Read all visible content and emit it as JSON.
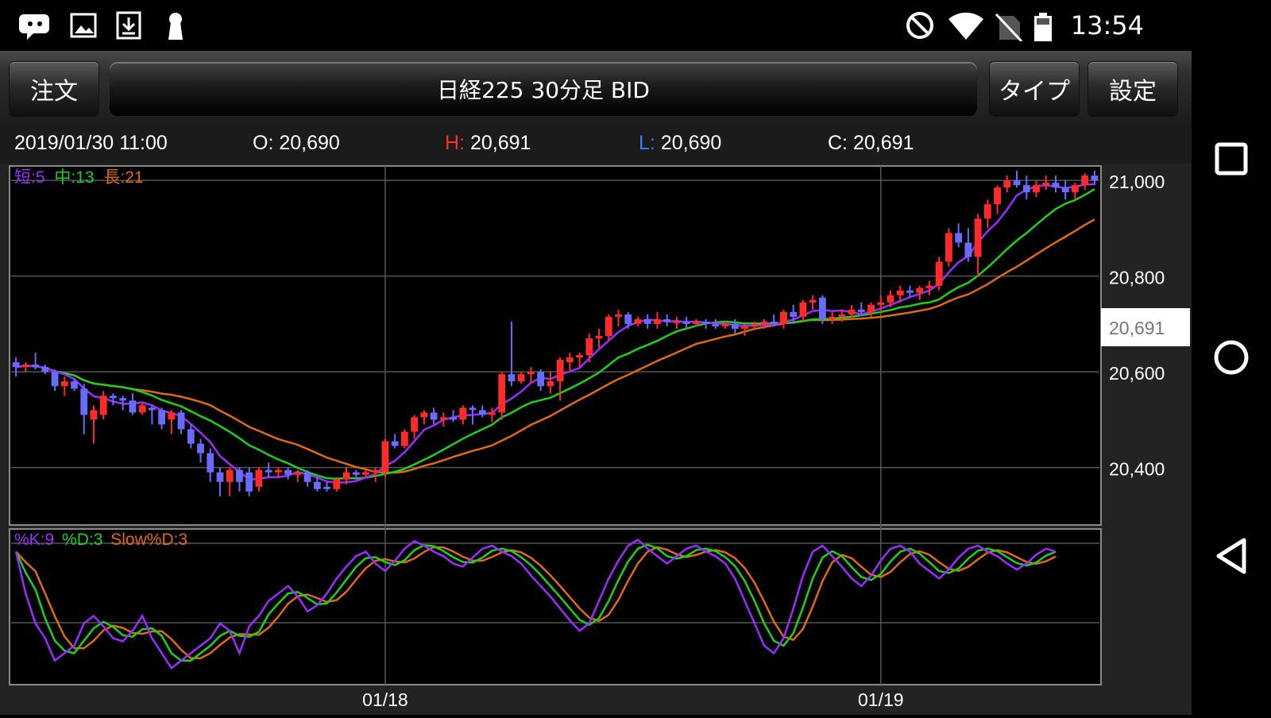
{
  "status_bar": {
    "time": "13:54",
    "left_icons": [
      "message-icon",
      "image-icon",
      "download-icon",
      "keyhole-icon"
    ],
    "right_icons": [
      "do-not-disturb-icon",
      "wifi-icon",
      "no-sim-icon",
      "battery-icon"
    ]
  },
  "toolbar": {
    "order_label": "注文",
    "title": "日経225 30分足 BID",
    "type_label": "タイプ",
    "settings_label": "設定"
  },
  "ohlc": {
    "datetime": "2019/01/30 11:00",
    "open_label": "O:",
    "open": "20,690",
    "high_label": "H:",
    "high": "20,691",
    "low_label": "L:",
    "low": "20,690",
    "close_label": "C:",
    "close": "20,691"
  },
  "colors": {
    "up": "#ff2a2a",
    "down": "#6a6aff",
    "ma_short": "#9a2cff",
    "ma_mid": "#1bd11b",
    "ma_long": "#e06a12",
    "high_label": "#ff3030",
    "low_label": "#3a7aff"
  },
  "legend": {
    "ma_short": "短:5",
    "ma_mid": "中:13",
    "ma_long": "長:21",
    "stoch_k": "%K:9",
    "stoch_d": "%D:3",
    "stoch_slow": "Slow%D:3"
  },
  "chart_data": {
    "type": "candlestick",
    "title": "日経225 30分足 BID",
    "y_ticks": [
      21000,
      20800,
      20600,
      20400
    ],
    "y_tick_labels": [
      "21,000",
      "20,800",
      "20,600",
      "20,400"
    ],
    "ylim": [
      20280,
      21030
    ],
    "current_price": 20691,
    "current_price_label": "20,691",
    "x_tick_labels": [
      "01/18",
      "01/19"
    ],
    "x_tick_index": [
      38,
      89
    ],
    "candles": [
      [
        20620,
        20630,
        20590,
        20610
      ],
      [
        20610,
        20620,
        20600,
        20615
      ],
      [
        20615,
        20640,
        20605,
        20610
      ],
      [
        20610,
        20615,
        20595,
        20600
      ],
      [
        20600,
        20605,
        20560,
        20570
      ],
      [
        20570,
        20590,
        20550,
        20580
      ],
      [
        20580,
        20585,
        20560,
        20565
      ],
      [
        20565,
        20575,
        20470,
        20510
      ],
      [
        20500,
        20530,
        20450,
        20520
      ],
      [
        20510,
        20560,
        20500,
        20550
      ],
      [
        20550,
        20555,
        20530,
        20545
      ],
      [
        20545,
        20550,
        20520,
        20540
      ],
      [
        20540,
        20555,
        20510,
        20515
      ],
      [
        20515,
        20535,
        20510,
        20530
      ],
      [
        20525,
        20530,
        20490,
        20520
      ],
      [
        20520,
        20525,
        20480,
        20490
      ],
      [
        20500,
        20520,
        20470,
        20515
      ],
      [
        20515,
        20520,
        20470,
        20480
      ],
      [
        20480,
        20490,
        20440,
        20450
      ],
      [
        20450,
        20460,
        20410,
        20430
      ],
      [
        20430,
        20440,
        20370,
        20390
      ],
      [
        20390,
        20400,
        20340,
        20370
      ],
      [
        20370,
        20400,
        20340,
        20395
      ],
      [
        20395,
        20400,
        20350,
        20370
      ],
      [
        20390,
        20400,
        20340,
        20350
      ],
      [
        20360,
        20400,
        20350,
        20395
      ],
      [
        20395,
        20410,
        20380,
        20390
      ],
      [
        20390,
        20400,
        20380,
        20395
      ],
      [
        20395,
        20400,
        20375,
        20385
      ],
      [
        20385,
        20395,
        20370,
        20390
      ],
      [
        20390,
        20395,
        20360,
        20370
      ],
      [
        20370,
        20380,
        20350,
        20355
      ],
      [
        20360,
        20370,
        20350,
        20355
      ],
      [
        20355,
        20380,
        20350,
        20375
      ],
      [
        20375,
        20400,
        20365,
        20390
      ],
      [
        20390,
        20395,
        20375,
        20385
      ],
      [
        20385,
        20395,
        20380,
        20390
      ],
      [
        20390,
        20400,
        20370,
        20395
      ],
      [
        20390,
        20460,
        20380,
        20455
      ],
      [
        20455,
        20470,
        20440,
        20445
      ],
      [
        20445,
        20480,
        20440,
        20475
      ],
      [
        20475,
        20510,
        20460,
        20505
      ],
      [
        20505,
        20520,
        20490,
        20515
      ],
      [
        20515,
        20525,
        20490,
        20500
      ],
      [
        20500,
        20515,
        20485,
        20505
      ],
      [
        20505,
        20520,
        20495,
        20500
      ],
      [
        20500,
        20530,
        20490,
        20525
      ],
      [
        20525,
        20530,
        20490,
        20520
      ],
      [
        20520,
        20530,
        20505,
        20510
      ],
      [
        20510,
        20525,
        20495,
        20515
      ],
      [
        20515,
        20600,
        20500,
        20595
      ],
      [
        20595,
        20705,
        20570,
        20580
      ],
      [
        20580,
        20600,
        20575,
        20595
      ],
      [
        20595,
        20610,
        20575,
        20600
      ],
      [
        20600,
        20605,
        20560,
        20570
      ],
      [
        20570,
        20600,
        20555,
        20580
      ],
      [
        20580,
        20630,
        20540,
        20625
      ],
      [
        20620,
        20640,
        20600,
        20630
      ],
      [
        20630,
        20640,
        20610,
        20635
      ],
      [
        20635,
        20680,
        20620,
        20670
      ],
      [
        20670,
        20690,
        20650,
        20675
      ],
      [
        20675,
        20720,
        20665,
        20715
      ],
      [
        20715,
        20730,
        20695,
        20720
      ],
      [
        20720,
        20725,
        20690,
        20700
      ],
      [
        20700,
        20715,
        20695,
        20710
      ],
      [
        20710,
        20720,
        20690,
        20700
      ],
      [
        20700,
        20725,
        20690,
        20710
      ],
      [
        20710,
        20720,
        20695,
        20705
      ],
      [
        20705,
        20715,
        20690,
        20705
      ],
      [
        20705,
        20715,
        20690,
        20700
      ],
      [
        20700,
        20710,
        20695,
        20705
      ],
      [
        20705,
        20710,
        20690,
        20700
      ],
      [
        20700,
        20710,
        20690,
        20695
      ],
      [
        20695,
        20705,
        20690,
        20700
      ],
      [
        20700,
        20710,
        20680,
        20690
      ],
      [
        20690,
        20700,
        20675,
        20695
      ],
      [
        20695,
        20705,
        20690,
        20700
      ],
      [
        20700,
        20710,
        20690,
        20705
      ],
      [
        20705,
        20720,
        20695,
        20700
      ],
      [
        20700,
        20730,
        20690,
        20725
      ],
      [
        20725,
        20740,
        20700,
        20715
      ],
      [
        20715,
        20750,
        20705,
        20745
      ],
      [
        20745,
        20760,
        20730,
        20750
      ],
      [
        20755,
        20760,
        20700,
        20710
      ],
      [
        20710,
        20725,
        20700,
        20715
      ],
      [
        20715,
        20730,
        20705,
        20720
      ],
      [
        20720,
        20740,
        20710,
        20730
      ],
      [
        20730,
        20745,
        20720,
        20725
      ],
      [
        20725,
        20745,
        20715,
        20740
      ],
      [
        20740,
        20760,
        20725,
        20745
      ],
      [
        20745,
        20770,
        20735,
        20760
      ],
      [
        20760,
        20780,
        20745,
        20770
      ],
      [
        20770,
        20780,
        20755,
        20765
      ],
      [
        20765,
        20780,
        20750,
        20775
      ],
      [
        20775,
        20790,
        20760,
        20780
      ],
      [
        20780,
        20840,
        20770,
        20830
      ],
      [
        20830,
        20900,
        20820,
        20890
      ],
      [
        20890,
        20910,
        20860,
        20870
      ],
      [
        20870,
        20900,
        20830,
        20840
      ],
      [
        20840,
        20930,
        20800,
        20920
      ],
      [
        20920,
        20960,
        20900,
        20950
      ],
      [
        20950,
        20990,
        20930,
        20985
      ],
      [
        20985,
        21010,
        20975,
        21000
      ],
      [
        21000,
        21020,
        20985,
        20990
      ],
      [
        20990,
        21010,
        20960,
        20975
      ],
      [
        20975,
        21000,
        20965,
        20990
      ],
      [
        20990,
        21010,
        20980,
        20995
      ],
      [
        20995,
        21010,
        20975,
        20985
      ],
      [
        20985,
        21000,
        20960,
        20975
      ],
      [
        20975,
        20995,
        20960,
        20990
      ],
      [
        20990,
        21015,
        20980,
        21010
      ],
      [
        21010,
        21020,
        20990,
        21000
      ]
    ],
    "stochastic_k": [
      88,
      60,
      40,
      30,
      15,
      20,
      25,
      40,
      45,
      38,
      30,
      28,
      35,
      45,
      30,
      20,
      10,
      15,
      20,
      25,
      30,
      40,
      35,
      20,
      38,
      45,
      55,
      60,
      65,
      58,
      48,
      52,
      60,
      70,
      78,
      85,
      88,
      80,
      75,
      82,
      90,
      95,
      92,
      88,
      85,
      80,
      78,
      84,
      90,
      92,
      88,
      85,
      80,
      72,
      65,
      58,
      50,
      42,
      35,
      40,
      55,
      70,
      82,
      92,
      96,
      90,
      85,
      80,
      85,
      90,
      92,
      88,
      85,
      80,
      70,
      55,
      40,
      25,
      20,
      30,
      50,
      72,
      88,
      92,
      85,
      78,
      70,
      65,
      72,
      82,
      90,
      92,
      88,
      80,
      75,
      70,
      76,
      84,
      90,
      92,
      88,
      85,
      80,
      76,
      80,
      86,
      90,
      88
    ]
  }
}
